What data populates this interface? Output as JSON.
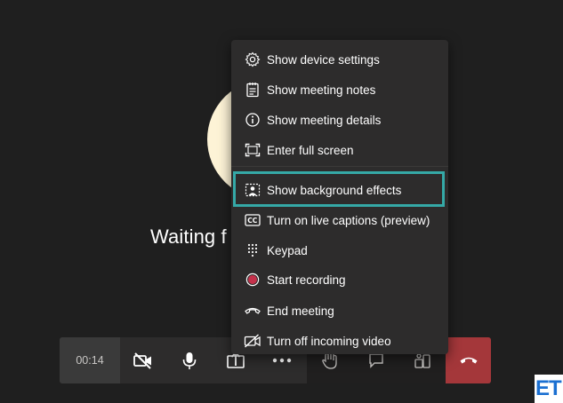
{
  "stage": {
    "waiting_text": "Waiting f"
  },
  "call_bar": {
    "timer": "00:14"
  },
  "menu": {
    "items": [
      {
        "label": "Show device settings",
        "icon": "gear-icon"
      },
      {
        "label": "Show meeting notes",
        "icon": "notes-icon"
      },
      {
        "label": "Show meeting details",
        "icon": "info-icon"
      },
      {
        "label": "Enter full screen",
        "icon": "fullscreen-icon"
      },
      {
        "label": "Show background effects",
        "icon": "background-effects-icon",
        "highlighted": true
      },
      {
        "label": "Turn on live captions (preview)",
        "icon": "captions-icon"
      },
      {
        "label": "Keypad",
        "icon": "keypad-icon"
      },
      {
        "label": "Start recording",
        "icon": "record-icon"
      },
      {
        "label": "End meeting",
        "icon": "end-meeting-icon"
      },
      {
        "label": "Turn off incoming video",
        "icon": "video-off-icon"
      }
    ]
  },
  "watermark": {
    "text": "ET"
  },
  "colors": {
    "background": "#1f1f1f",
    "menu_bg": "#2d2c2c",
    "highlight_border": "#35a9a7",
    "hangup": "#a4373a",
    "record_dot": "#c4314b",
    "avatar": "#fdf3d6"
  }
}
